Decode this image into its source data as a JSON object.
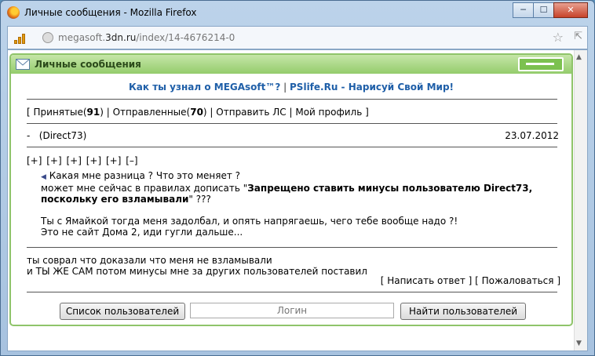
{
  "window": {
    "title": "Личные сообщения - Mozilla Firefox"
  },
  "address": {
    "url_prefix": "megasoft.",
    "url_host": "3dn.ru",
    "url_path": "/index/14-4676214-0"
  },
  "panel": {
    "title": "Личные сообщения",
    "promo_left": "Как ты узнал о MEGAsoft™?",
    "promo_sep": " | ",
    "promo_right": "PSlife.Ru - Нарисуй Свой Мир!"
  },
  "nav": {
    "open": "[ ",
    "received_label": "Принятые(",
    "received_count": "91",
    "sent_label": "Отправленные(",
    "sent_count": "70",
    "close_paren": ")",
    "sep": " | ",
    "send_label": "Отправить ЛС",
    "profile_label": "Мой профиль",
    "close": " ]"
  },
  "message": {
    "dash": "-",
    "sender": "(Direct73)",
    "date": "23.07.2012",
    "expanders": [
      "[+]",
      "[+]",
      "[+]",
      "[+]",
      "[+]",
      "[–]"
    ],
    "quote_line1": "Какая мне разница ? Что это меняет ?",
    "quote_line2_pre": "может мне сейчас в правилах дописать \"",
    "quote_line2_bold": "Запрещено ставить минусы пользователю Direct73, поскольку его взламывали",
    "quote_line2_post": "\" ???",
    "quote_line3": "Ты с Ямайкой тогда меня задолбал, и опять напрягаешь, чего тебе вообще надо ?!",
    "quote_line4": "Это не сайт Дома 2, иди гугли дальше...",
    "reply_line1": "ты соврал что доказали что меня не взламывали",
    "reply_line2": "и ТЫ ЖЕ САМ потом минусы мне за других пользователей поставил"
  },
  "actions": {
    "reply": "Написать ответ",
    "complain": "Пожаловаться"
  },
  "bottom": {
    "users_list": "Список пользователей",
    "login_placeholder": "Логин",
    "find_users": "Найти пользователей"
  }
}
